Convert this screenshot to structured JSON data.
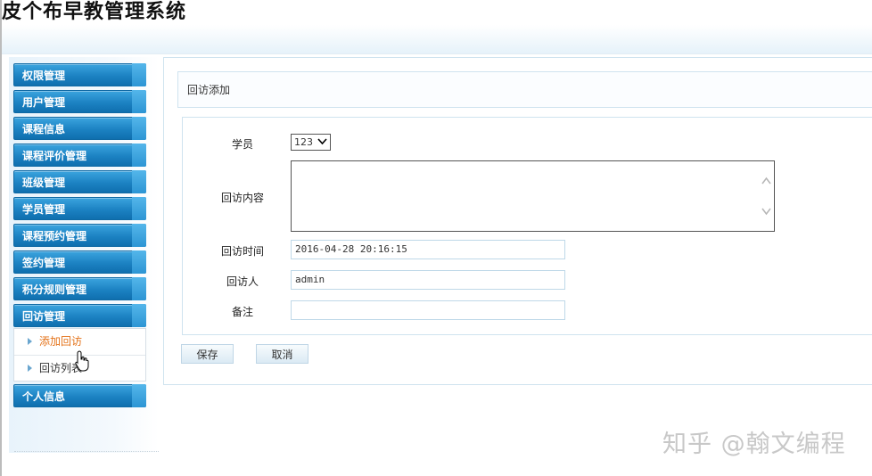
{
  "app": {
    "title": "皮个布早教管理系统"
  },
  "sidebar": {
    "groups": [
      {
        "label": "权限管理"
      },
      {
        "label": "用户管理"
      },
      {
        "label": "课程信息"
      },
      {
        "label": "课程评价管理"
      },
      {
        "label": "班级管理"
      },
      {
        "label": "学员管理"
      },
      {
        "label": "课程预约管理"
      },
      {
        "label": "签约管理"
      },
      {
        "label": "积分规则管理"
      },
      {
        "label": "回访管理"
      },
      {
        "label": "个人信息"
      }
    ],
    "sub_items": [
      {
        "label": "添加回访",
        "active": true
      },
      {
        "label": "回访列表",
        "active": false
      }
    ]
  },
  "main": {
    "title": "回访添加",
    "form": {
      "student_label": "学员",
      "student_value": "123",
      "content_label": "回访内容",
      "content_value": "",
      "time_label": "回访时间",
      "time_value": "2016-04-28 20:16:15",
      "visitor_label": "回访人",
      "visitor_value": "admin",
      "note_label": "备注",
      "note_value": ""
    },
    "buttons": {
      "save": "保存",
      "cancel": "取消"
    }
  },
  "watermark": "知乎 @翰文编程",
  "colors": {
    "menu_blue": "#1c82c3",
    "active_orange": "#e4731a",
    "border_light_blue": "#cfe3ef"
  }
}
